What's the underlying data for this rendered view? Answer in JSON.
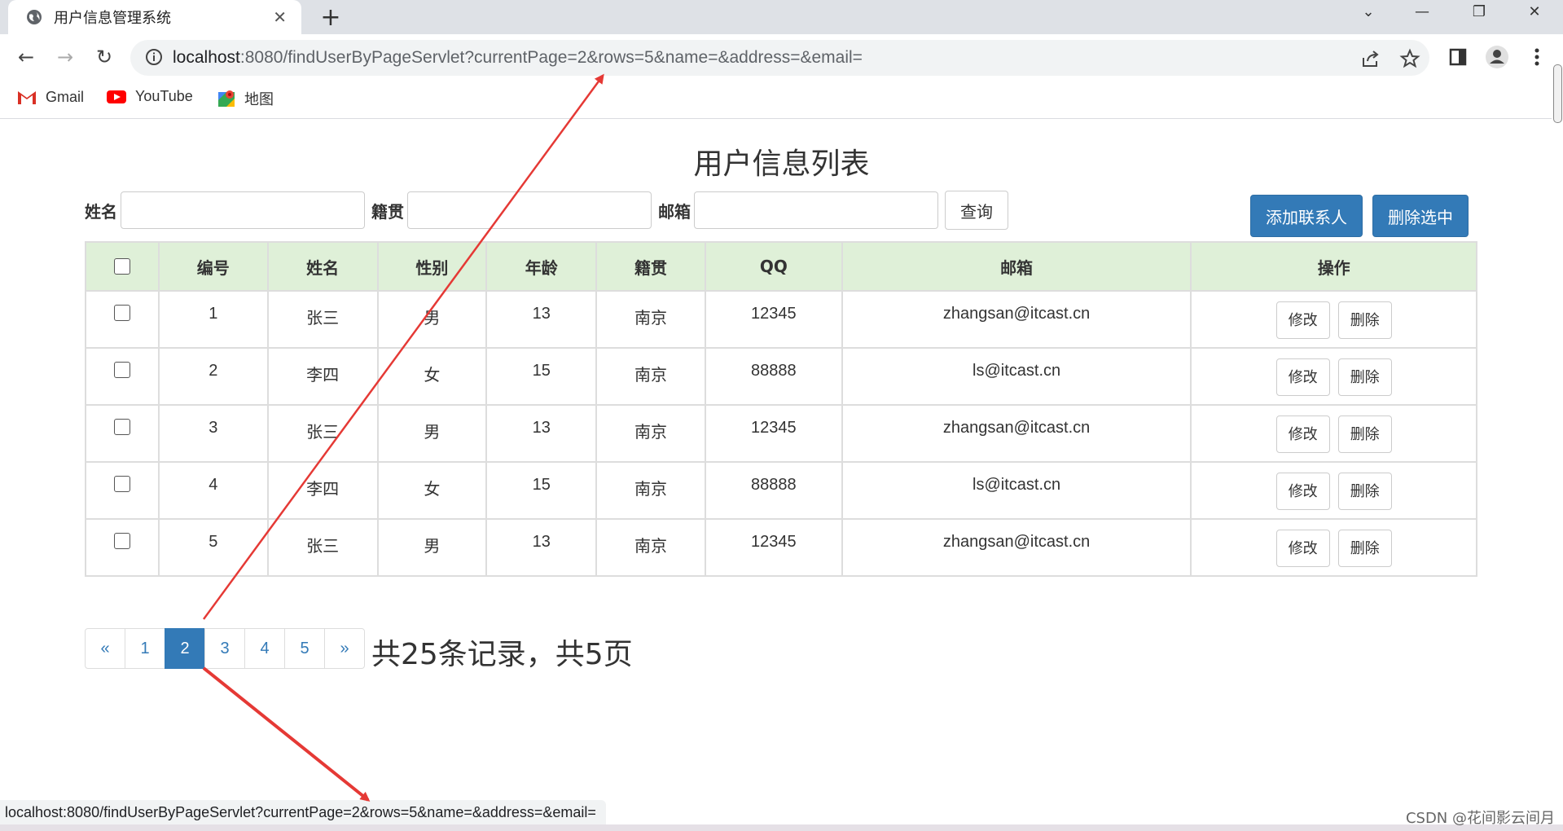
{
  "browser": {
    "tab_title": "用户信息管理系统",
    "url_host": "localhost",
    "url_rest": ":8080/findUserByPageServlet?currentPage=2&rows=5&name=&address=&email=",
    "bookmarks": [
      {
        "label": "Gmail",
        "icon": "gmail-icon"
      },
      {
        "label": "YouTube",
        "icon": "youtube-icon"
      },
      {
        "label": "地图",
        "icon": "maps-icon"
      }
    ],
    "status_url": "localhost:8080/findUserByPageServlet?currentPage=2&rows=5&name=&address=&email="
  },
  "page": {
    "title": "用户信息列表",
    "search": {
      "name_label": "姓名",
      "address_label": "籍贯",
      "email_label": "邮箱",
      "submit_label": "查询"
    },
    "add_label": "添加联系人",
    "delete_selected_label": "删除选中",
    "table": {
      "headers": [
        "编号",
        "姓名",
        "性别",
        "年龄",
        "籍贯",
        "QQ",
        "邮箱",
        "操作"
      ],
      "rows": [
        {
          "id": "1",
          "name": "张三",
          "gender": "男",
          "age": "13",
          "address": "南京",
          "qq": "12345",
          "email": "zhangsan@itcast.cn"
        },
        {
          "id": "2",
          "name": "李四",
          "gender": "女",
          "age": "15",
          "address": "南京",
          "qq": "88888",
          "email": "ls@itcast.cn"
        },
        {
          "id": "3",
          "name": "张三",
          "gender": "男",
          "age": "13",
          "address": "南京",
          "qq": "12345",
          "email": "zhangsan@itcast.cn"
        },
        {
          "id": "4",
          "name": "李四",
          "gender": "女",
          "age": "15",
          "address": "南京",
          "qq": "88888",
          "email": "ls@itcast.cn"
        },
        {
          "id": "5",
          "name": "张三",
          "gender": "男",
          "age": "13",
          "address": "南京",
          "qq": "12345",
          "email": "zhangsan@itcast.cn"
        }
      ],
      "edit_label": "修改",
      "delete_label": "删除"
    },
    "pagination": {
      "prev": "«",
      "pages": [
        "1",
        "2",
        "3",
        "4",
        "5"
      ],
      "active": "2",
      "next": "»",
      "summary": "共25条记录，共5页"
    }
  },
  "watermark": "CSDN @花间影云间月",
  "colors": {
    "primary": "#337ab7",
    "header_bg": "#dff0d8",
    "annotation_arrow": "#e53935"
  }
}
